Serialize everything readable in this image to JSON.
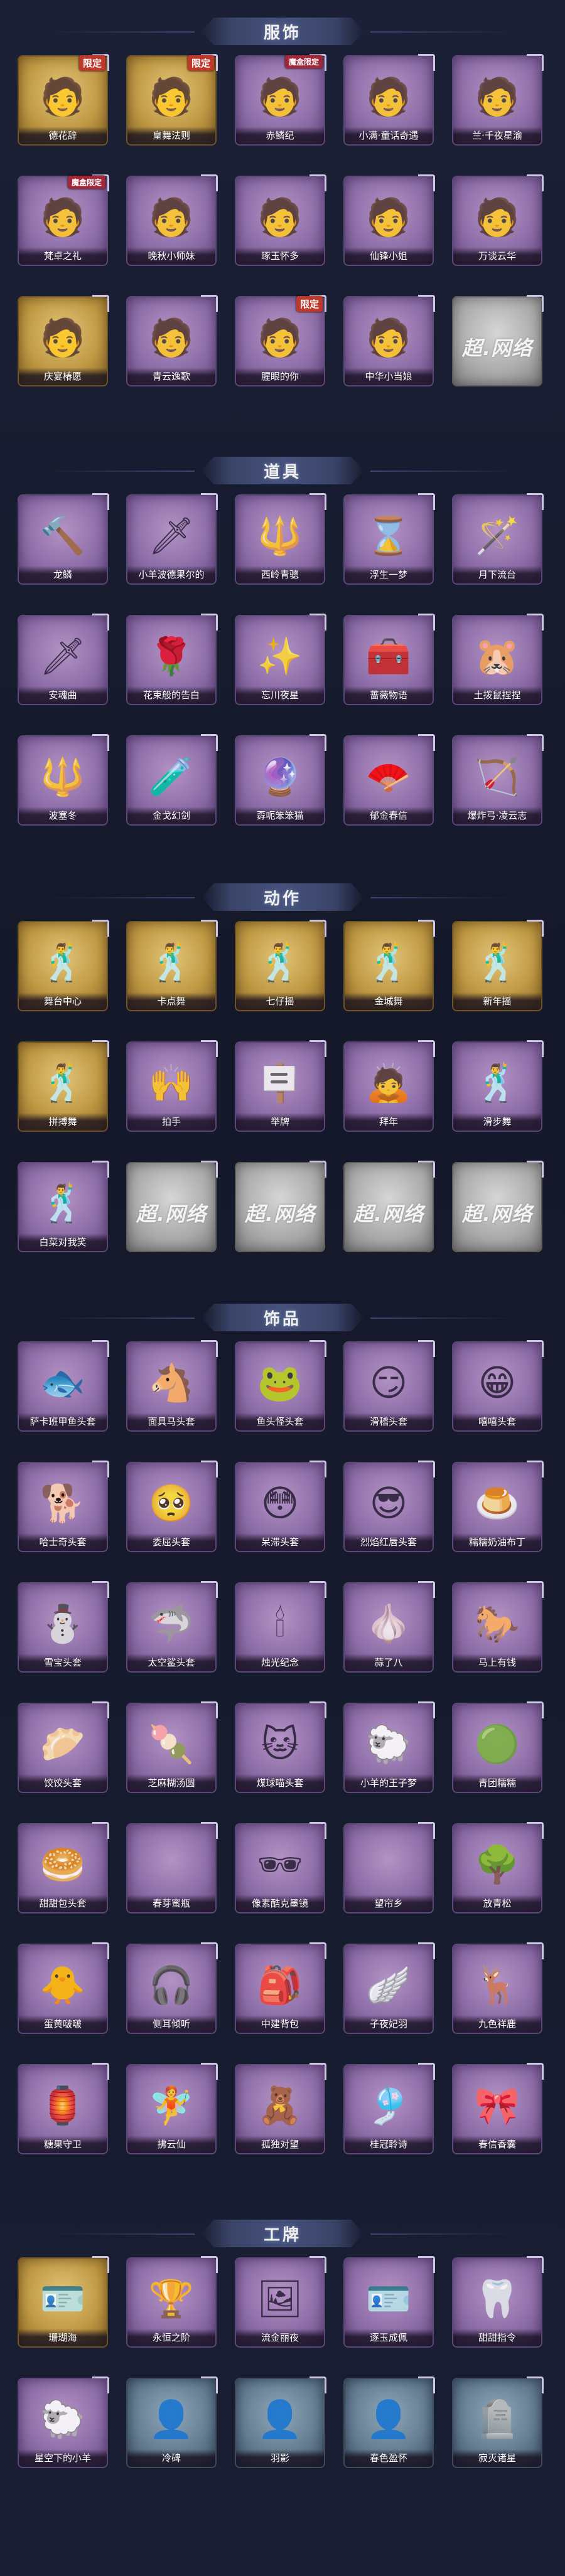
{
  "sections": [
    {
      "title": "服饰",
      "items": [
        {
          "label": "德花辞",
          "style": "gold",
          "icon": "🧑",
          "tag": "限定"
        },
        {
          "label": "皇舞法则",
          "style": "gold",
          "icon": "🧑",
          "tag": "限定"
        },
        {
          "label": "赤鳞纪",
          "style": "purple",
          "icon": "🧑",
          "tag": "",
          "marker": "魔盒限定"
        },
        {
          "label": "小满·童话奇遇",
          "style": "purple",
          "icon": "🧑",
          "tag": ""
        },
        {
          "label": "兰·千夜星渝",
          "style": "purple",
          "icon": "🧑",
          "tag": ""
        },
        {
          "label": "梵卓之礼",
          "style": "purple",
          "icon": "🧑",
          "tag": "",
          "marker": "魔盒限定"
        },
        {
          "label": "晚秋小师妹",
          "style": "purple",
          "icon": "🧑",
          "tag": ""
        },
        {
          "label": "琢玉怀多",
          "style": "purple",
          "icon": "🧑",
          "tag": ""
        },
        {
          "label": "仙锋小姐",
          "style": "purple",
          "icon": "🧑",
          "tag": ""
        },
        {
          "label": "万谈云华",
          "style": "purple",
          "icon": "🧑",
          "tag": ""
        },
        {
          "label": "庆宴椿愿",
          "style": "gold",
          "icon": "🧑",
          "tag": ""
        },
        {
          "label": "青云逸歌",
          "style": "purple",
          "icon": "🧑",
          "tag": ""
        },
        {
          "label": "腥眼的你",
          "style": "purple",
          "icon": "🧑",
          "tag": "限定"
        },
        {
          "label": "中华小当娘",
          "style": "purple",
          "icon": "🧑",
          "tag": ""
        },
        {
          "label": "",
          "style": "grey",
          "icon": "",
          "tag": "",
          "placeholder": "超.网络"
        }
      ]
    },
    {
      "title": "道具",
      "items": [
        {
          "label": "龙鳞",
          "style": "purple",
          "icon": "🔨",
          "tag": ""
        },
        {
          "label": "小羊波德果尔的",
          "style": "purple",
          "icon": "🗡",
          "tag": ""
        },
        {
          "label": "西岭青骢",
          "style": "purple",
          "icon": "🔱",
          "tag": ""
        },
        {
          "label": "浮生一梦",
          "style": "purple",
          "icon": "⌛",
          "tag": ""
        },
        {
          "label": "月下流台",
          "style": "purple",
          "icon": "🪄",
          "tag": ""
        },
        {
          "label": "安魂曲",
          "style": "purple",
          "icon": "🗡",
          "tag": ""
        },
        {
          "label": "花束般的告白",
          "style": "purple",
          "icon": "🌹",
          "tag": ""
        },
        {
          "label": "忘川夜星",
          "style": "purple",
          "icon": "✨",
          "tag": ""
        },
        {
          "label": "蔷薇物语",
          "style": "purple",
          "icon": "🧰",
          "tag": ""
        },
        {
          "label": "土拨鼠捏捏",
          "style": "purple",
          "icon": "🐹",
          "tag": ""
        },
        {
          "label": "波塞冬",
          "style": "purple",
          "icon": "🔱",
          "tag": ""
        },
        {
          "label": "金戈幻剑",
          "style": "purple",
          "icon": "🧪",
          "tag": ""
        },
        {
          "label": "孬呃笨笨猫",
          "style": "purple",
          "icon": "🔮",
          "tag": ""
        },
        {
          "label": "郁金春信",
          "style": "purple",
          "icon": "🪭",
          "tag": ""
        },
        {
          "label": "爆炸弓·凌云志",
          "style": "purple",
          "icon": "🏹",
          "tag": ""
        }
      ]
    },
    {
      "title": "动作",
      "items": [
        {
          "label": "舞台中心",
          "style": "gold",
          "icon": "🕺",
          "tag": ""
        },
        {
          "label": "卡点舞",
          "style": "gold",
          "icon": "🕺",
          "tag": ""
        },
        {
          "label": "七仔摇",
          "style": "gold",
          "icon": "🕺",
          "tag": ""
        },
        {
          "label": "金城舞",
          "style": "gold",
          "icon": "🕺",
          "tag": ""
        },
        {
          "label": "新年摇",
          "style": "gold",
          "icon": "🕺",
          "tag": ""
        },
        {
          "label": "拼搏舞",
          "style": "gold",
          "icon": "🕺",
          "tag": ""
        },
        {
          "label": "拍手",
          "style": "purple",
          "icon": "🙌",
          "tag": ""
        },
        {
          "label": "举牌",
          "style": "purple",
          "icon": "🪧",
          "tag": ""
        },
        {
          "label": "拜年",
          "style": "purple",
          "icon": "🙇",
          "tag": ""
        },
        {
          "label": "滑步舞",
          "style": "purple",
          "icon": "🕺",
          "tag": ""
        },
        {
          "label": "白菜对我笑",
          "style": "purple",
          "icon": "🕺",
          "tag": ""
        },
        {
          "label": "",
          "style": "grey",
          "icon": "",
          "tag": "",
          "placeholder": "超.网络"
        },
        {
          "label": "",
          "style": "grey",
          "icon": "",
          "tag": "",
          "placeholder": "超.网络"
        },
        {
          "label": "",
          "style": "grey",
          "icon": "",
          "tag": "",
          "placeholder": "超.网络"
        },
        {
          "label": "",
          "style": "grey",
          "icon": "",
          "tag": "",
          "placeholder": "超.网络"
        }
      ]
    },
    {
      "title": "饰品",
      "items": [
        {
          "label": "萨卡班甲鱼头套",
          "style": "purple",
          "icon": "🐟",
          "tag": ""
        },
        {
          "label": "面具马头套",
          "style": "purple",
          "icon": "🐴",
          "tag": ""
        },
        {
          "label": "鱼头怪头套",
          "style": "purple",
          "icon": "🐸",
          "tag": ""
        },
        {
          "label": "滑稽头套",
          "style": "purple",
          "icon": "😏",
          "tag": ""
        },
        {
          "label": "嘻嘻头套",
          "style": "purple",
          "icon": "😁",
          "tag": ""
        },
        {
          "label": "哈士奇头套",
          "style": "purple",
          "icon": "🐕",
          "tag": ""
        },
        {
          "label": "委屈头套",
          "style": "purple",
          "icon": "🥺",
          "tag": ""
        },
        {
          "label": "呆滞头套",
          "style": "purple",
          "icon": "😳",
          "tag": ""
        },
        {
          "label": "烈焰红唇头套",
          "style": "purple",
          "icon": "😎",
          "tag": ""
        },
        {
          "label": "糯糯奶油布丁",
          "style": "purple",
          "icon": "🍮",
          "tag": ""
        },
        {
          "label": "雪宝头套",
          "style": "purple",
          "icon": "⛄",
          "tag": ""
        },
        {
          "label": "太空鲨头套",
          "style": "purple",
          "icon": "🦈",
          "tag": ""
        },
        {
          "label": "烛光纪念",
          "style": "purple",
          "icon": "🕯",
          "tag": ""
        },
        {
          "label": "蒜了八",
          "style": "purple",
          "icon": "🧄",
          "tag": ""
        },
        {
          "label": "马上有钱",
          "style": "purple",
          "icon": "🐎",
          "tag": ""
        },
        {
          "label": "饺饺头套",
          "style": "purple",
          "icon": "🥟",
          "tag": ""
        },
        {
          "label": "芝麻糊汤圆",
          "style": "purple",
          "icon": "🍡",
          "tag": ""
        },
        {
          "label": "煤球喵头套",
          "style": "purple",
          "icon": "🐱",
          "tag": ""
        },
        {
          "label": "小羊的王子梦",
          "style": "purple",
          "icon": "🐑",
          "tag": ""
        },
        {
          "label": "青团糯糯",
          "style": "purple",
          "icon": "🟢",
          "tag": ""
        },
        {
          "label": "甜甜包头套",
          "style": "purple",
          "icon": "🥯",
          "tag": ""
        },
        {
          "label": "春芽蜜瓶",
          "style": "purple",
          "icon": "",
          "tag": ""
        },
        {
          "label": "像素酷克墨镜",
          "style": "purple",
          "icon": "🕶",
          "tag": ""
        },
        {
          "label": "望帘乡",
          "style": "purple",
          "icon": "",
          "tag": ""
        },
        {
          "label": "放青松",
          "style": "purple",
          "icon": "🌳",
          "tag": ""
        },
        {
          "label": "蛋黄啵啵",
          "style": "purple",
          "icon": "🐥",
          "tag": ""
        },
        {
          "label": "侧耳倾听",
          "style": "purple",
          "icon": "🎧",
          "tag": ""
        },
        {
          "label": "中建背包",
          "style": "purple",
          "icon": "🎒",
          "tag": ""
        },
        {
          "label": "子夜妃羽",
          "style": "purple",
          "icon": "🪽",
          "tag": ""
        },
        {
          "label": "九色祥鹿",
          "style": "purple",
          "icon": "🦌",
          "tag": ""
        },
        {
          "label": "糖果守卫",
          "style": "purple",
          "icon": "🏮",
          "tag": ""
        },
        {
          "label": "拂云仙",
          "style": "purple",
          "icon": "🧚",
          "tag": ""
        },
        {
          "label": "孤独对望",
          "style": "purple",
          "icon": "🧸",
          "tag": ""
        },
        {
          "label": "桂冠聆诗",
          "style": "purple",
          "icon": "🎐",
          "tag": ""
        },
        {
          "label": "春信香囊",
          "style": "purple",
          "icon": "🎀",
          "tag": ""
        }
      ]
    },
    {
      "title": "工牌",
      "items": [
        {
          "label": "珊瑚海",
          "style": "gold",
          "icon": "🪪",
          "tag": ""
        },
        {
          "label": "永恒之阶",
          "style": "purple",
          "icon": "🏆",
          "tag": ""
        },
        {
          "label": "流金丽夜",
          "style": "purple",
          "icon": "🖼",
          "tag": ""
        },
        {
          "label": "逐玉成佩",
          "style": "purple",
          "icon": "🪪",
          "tag": ""
        },
        {
          "label": "甜甜指令",
          "style": "purple",
          "icon": "🦷",
          "tag": ""
        },
        {
          "label": "星空下的小羊",
          "style": "purple",
          "icon": "🐑",
          "tag": ""
        },
        {
          "label": "冷碑",
          "style": "blue",
          "icon": "👤",
          "tag": ""
        },
        {
          "label": "羽影",
          "style": "blue",
          "icon": "👤",
          "tag": ""
        },
        {
          "label": "春色盈怀",
          "style": "blue",
          "icon": "👤",
          "tag": ""
        },
        {
          "label": "寂灭诸星",
          "style": "blue",
          "icon": "🪦",
          "tag": ""
        }
      ]
    }
  ]
}
